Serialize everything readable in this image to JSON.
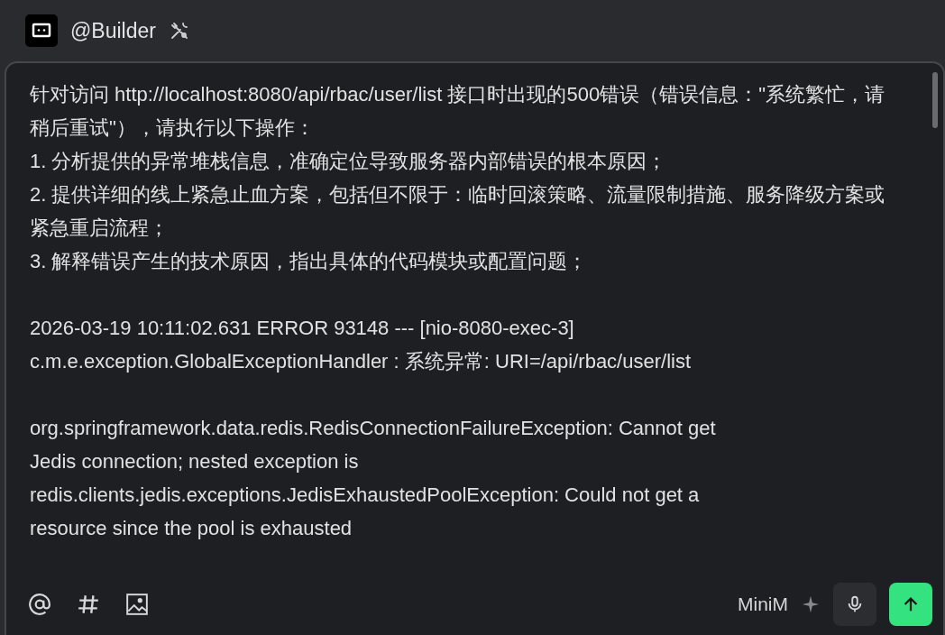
{
  "header": {
    "title": "@Builder"
  },
  "composer": {
    "blocks": [
      [
        "针对访问 http://localhost:8080/api/rbac/user/list 接口时出现的500错误（错误信息：\"系统繁忙，请稍后重试\"），请执行以下操作：",
        "1. 分析提供的异常堆栈信息，准确定位导致服务器内部错误的根本原因；",
        "2. 提供详细的线上紧急止血方案，包括但不限于：临时回滚策略、流量限制措施、服务降级方案或紧急重启流程；",
        "3. 解释错误产生的技术原因，指出具体的代码模块或配置问题；"
      ],
      [
        "2026-03-19 10:11:02.631 ERROR 93148 --- [nio-8080-exec-3]",
        "c.m.e.exception.GlobalExceptionHandler   : 系统异常: URI=/api/rbac/user/list"
      ],
      [
        "org.springframework.data.redis.RedisConnectionFailureException: Cannot get",
        "Jedis connection; nested exception is",
        "redis.clients.jedis.exceptions.JedisExhaustedPoolException: Could not get a",
        "resource since the pool is exhausted"
      ]
    ],
    "model": "MiniM"
  }
}
